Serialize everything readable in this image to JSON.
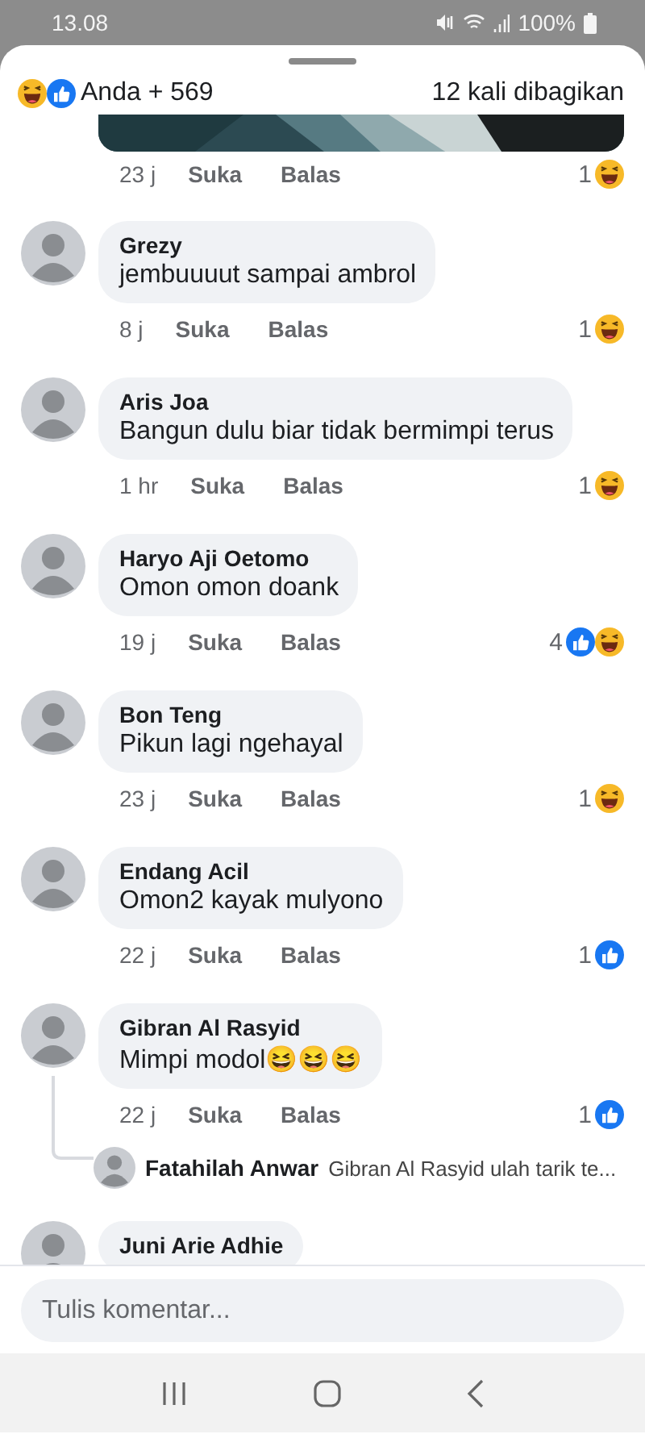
{
  "status_bar": {
    "time": "13.08",
    "battery": "100%"
  },
  "header": {
    "reactions": [
      {
        "kind": "haha"
      },
      {
        "kind": "like"
      }
    ],
    "summary": "Anda + 569",
    "shares": "12 kali dibagikan"
  },
  "post_footer": {
    "time": "23 j",
    "like": "Suka",
    "reply": "Balas",
    "count": "1",
    "reactions": [
      {
        "kind": "haha"
      }
    ]
  },
  "comments": [
    {
      "name": "Grezy",
      "text": "jembuuuut sampai ambrol",
      "time": "8 j",
      "like": "Suka",
      "reply": "Balas",
      "count": "1",
      "reactions": [
        {
          "kind": "haha"
        }
      ]
    },
    {
      "name": "Aris Joa",
      "text": "Bangun dulu biar tidak bermimpi terus",
      "time": "1 hr",
      "like": "Suka",
      "reply": "Balas",
      "count": "1",
      "reactions": [
        {
          "kind": "haha"
        }
      ]
    },
    {
      "name": "Haryo Aji Oetomo",
      "text": "Omon omon doank",
      "time": "19 j",
      "like": "Suka",
      "reply": "Balas",
      "count": "4",
      "reactions": [
        {
          "kind": "like"
        },
        {
          "kind": "haha"
        }
      ]
    },
    {
      "name": "Bon Teng",
      "text": "Pikun lagi ngehayal",
      "time": "23 j",
      "like": "Suka",
      "reply": "Balas",
      "count": "1",
      "reactions": [
        {
          "kind": "haha"
        }
      ]
    },
    {
      "name": "Endang Acil",
      "text": "Omon2 kayak mulyono",
      "time": "22 j",
      "like": "Suka",
      "reply": "Balas",
      "count": "1",
      "reactions": [
        {
          "kind": "like"
        }
      ]
    },
    {
      "name": "Gibran Al Rasyid",
      "text": "Mimpi modol😆😆😆",
      "time": "22 j",
      "like": "Suka",
      "reply": "Balas",
      "count": "1",
      "reactions": [
        {
          "kind": "like"
        }
      ],
      "reply_preview": {
        "name": "Fatahilah Anwar",
        "text": "Gibran Al Rasyid ulah  tarik te..."
      }
    },
    {
      "name": "Juni Arie Adhie"
    }
  ],
  "composer": {
    "placeholder": "Tulis komentar..."
  }
}
